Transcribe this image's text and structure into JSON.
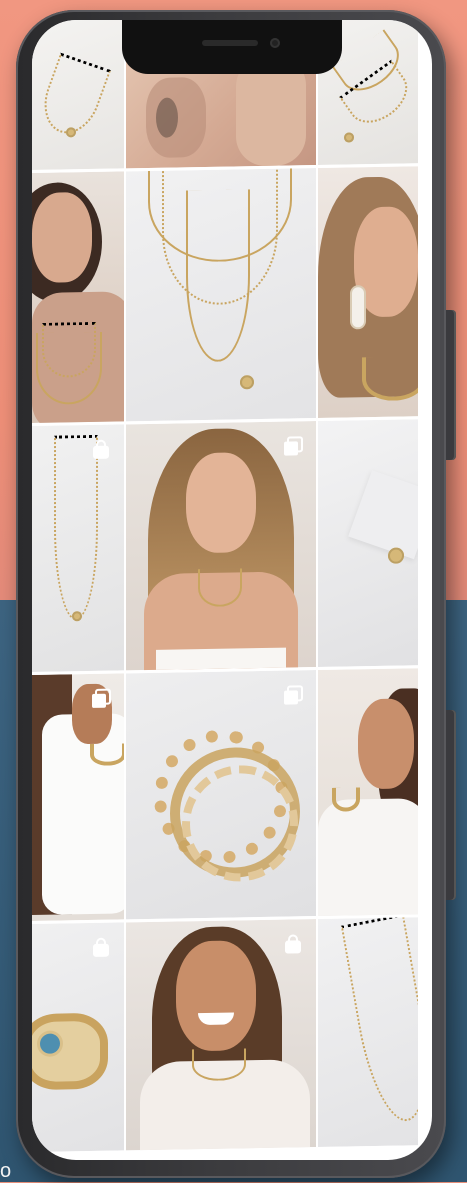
{
  "app": {
    "accent": "#c9a560",
    "background_top": "#f19781",
    "background_bottom": "#3d6481",
    "bottom_glyph": "o"
  },
  "feed": {
    "tiles": [
      {
        "row": 1,
        "col": 1,
        "subject": "gold-necklace-on-white",
        "badge": "none"
      },
      {
        "row": 1,
        "col": 2,
        "subject": "tattooed-arm-beige-top",
        "badge": "none"
      },
      {
        "row": 1,
        "col": 3,
        "subject": "gold-chains-flatlay",
        "badge": "none"
      },
      {
        "row": 2,
        "col": 1,
        "subject": "model-brown-hair-layered-necklaces",
        "badge": "none"
      },
      {
        "row": 2,
        "col": 2,
        "subject": "layered-necklaces-on-white",
        "badge": "none"
      },
      {
        "row": 2,
        "col": 3,
        "subject": "model-blonde-hoop-earrings",
        "badge": "none"
      },
      {
        "row": 3,
        "col": 1,
        "subject": "long-chain-on-white",
        "badge": "shopping-bag-icon"
      },
      {
        "row": 3,
        "col": 2,
        "subject": "model-blonde-white-camisole",
        "badge": "carousel-icon"
      },
      {
        "row": 3,
        "col": 3,
        "subject": "charm-on-white-fabric",
        "badge": "none"
      },
      {
        "row": 4,
        "col": 1,
        "subject": "model-white-shirt-bracelet",
        "badge": "carousel-icon"
      },
      {
        "row": 4,
        "col": 2,
        "subject": "gold-bracelet-stack",
        "badge": "carousel-icon"
      },
      {
        "row": 4,
        "col": 3,
        "subject": "model-smiling-white-shirt",
        "badge": "none"
      },
      {
        "row": 5,
        "col": 1,
        "subject": "gold-ring-blue-stone",
        "badge": "shopping-bag-icon"
      },
      {
        "row": 5,
        "col": 2,
        "subject": "model-smiling-gold-necklace",
        "badge": "shopping-bag-icon"
      },
      {
        "row": 5,
        "col": 3,
        "subject": "thin-chain-on-white",
        "badge": "none"
      }
    ]
  }
}
